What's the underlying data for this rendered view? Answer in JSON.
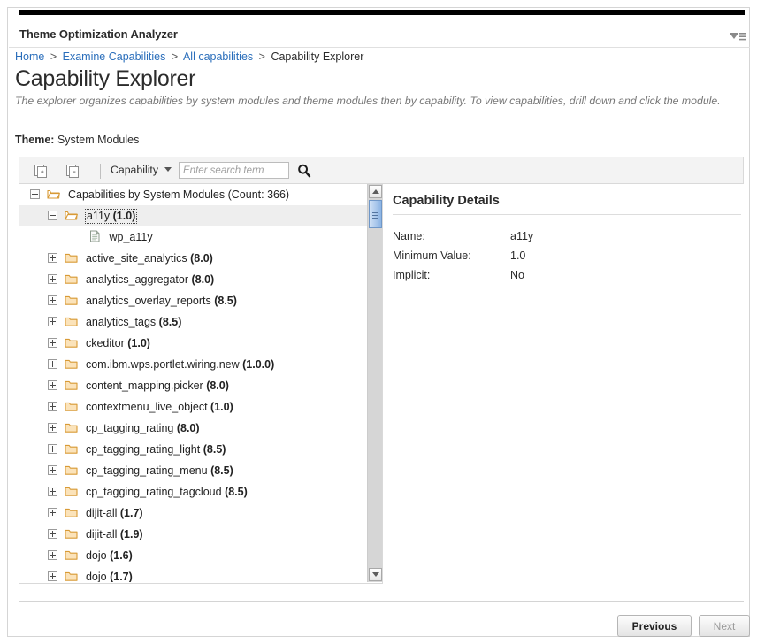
{
  "window": {
    "app_title": "Theme Optimization Analyzer",
    "corner_menu_icon": "options-menu-icon"
  },
  "breadcrumb": {
    "items": [
      {
        "label": "Home",
        "link": true
      },
      {
        "label": "Examine Capabilities",
        "link": true
      },
      {
        "label": "All capabilities",
        "link": true
      },
      {
        "label": "Capability Explorer",
        "link": false
      }
    ],
    "separator": ">"
  },
  "page": {
    "title": "Capability Explorer",
    "description": "The explorer organizes capabilities by system modules and theme modules then by capability. To view capabilities, drill down and click the module.",
    "theme_label": "Theme:",
    "theme_value": "System Modules"
  },
  "toolbar": {
    "expand_all_icon": "expand-all-icon",
    "collapse_all_icon": "collapse-all-icon",
    "filter_label": "Capability",
    "caret_icon": "chevron-down-icon",
    "search_placeholder": "Enter search term",
    "search_value": "",
    "search_icon": "search-icon"
  },
  "tree": {
    "root": {
      "label": "Capabilities by System Modules (Count: 366)",
      "icon": "folder-open-icon",
      "expanded": true
    },
    "nodes": [
      {
        "label": "a11y",
        "version": "(1.0)",
        "icon": "folder-open-icon",
        "expanded": true,
        "selected": true,
        "focused": true,
        "depth": 1
      },
      {
        "label": "wp_a11y",
        "version": "",
        "icon": "document-icon",
        "leaf": true,
        "depth": 2
      },
      {
        "label": "active_site_analytics",
        "version": "(8.0)",
        "icon": "folder-icon",
        "expanded": false,
        "depth": 1
      },
      {
        "label": "analytics_aggregator",
        "version": "(8.0)",
        "icon": "folder-icon",
        "expanded": false,
        "depth": 1
      },
      {
        "label": "analytics_overlay_reports",
        "version": "(8.5)",
        "icon": "folder-icon",
        "expanded": false,
        "depth": 1
      },
      {
        "label": "analytics_tags",
        "version": "(8.5)",
        "icon": "folder-icon",
        "expanded": false,
        "depth": 1
      },
      {
        "label": "ckeditor",
        "version": "(1.0)",
        "icon": "folder-icon",
        "expanded": false,
        "depth": 1
      },
      {
        "label": "com.ibm.wps.portlet.wiring.new",
        "version": "(1.0.0)",
        "icon": "folder-icon",
        "expanded": false,
        "depth": 1
      },
      {
        "label": "content_mapping.picker",
        "version": "(8.0)",
        "icon": "folder-icon",
        "expanded": false,
        "depth": 1
      },
      {
        "label": "contextmenu_live_object",
        "version": "(1.0)",
        "icon": "folder-icon",
        "expanded": false,
        "depth": 1
      },
      {
        "label": "cp_tagging_rating",
        "version": "(8.0)",
        "icon": "folder-icon",
        "expanded": false,
        "depth": 1
      },
      {
        "label": "cp_tagging_rating_light",
        "version": "(8.5)",
        "icon": "folder-icon",
        "expanded": false,
        "depth": 1
      },
      {
        "label": "cp_tagging_rating_menu",
        "version": "(8.5)",
        "icon": "folder-icon",
        "expanded": false,
        "depth": 1
      },
      {
        "label": "cp_tagging_rating_tagcloud",
        "version": "(8.5)",
        "icon": "folder-icon",
        "expanded": false,
        "depth": 1
      },
      {
        "label": "dijit-all",
        "version": "(1.7)",
        "icon": "folder-icon",
        "expanded": false,
        "depth": 1
      },
      {
        "label": "dijit-all",
        "version": "(1.9)",
        "icon": "folder-icon",
        "expanded": false,
        "depth": 1
      },
      {
        "label": "dojo",
        "version": "(1.6)",
        "icon": "folder-icon",
        "expanded": false,
        "depth": 1
      },
      {
        "label": "dojo",
        "version": "(1.7)",
        "icon": "folder-icon",
        "expanded": false,
        "depth": 1
      }
    ],
    "scrollbar": {
      "up_arrow_icon": "scroll-up-icon",
      "down_arrow_icon": "scroll-down-icon"
    }
  },
  "details": {
    "title": "Capability Details",
    "rows": [
      {
        "key": "Name:",
        "value": "a11y"
      },
      {
        "key": "Minimum Value:",
        "value": "1.0"
      },
      {
        "key": "Implicit:",
        "value": "No"
      }
    ]
  },
  "footer": {
    "previous_label": "Previous",
    "next_label": "Next",
    "next_disabled": true
  },
  "colors": {
    "link": "#2a6ebb",
    "folder": "#e8a33d",
    "selection": "#eeeeee",
    "scroll_thumb": "#8cb4e4",
    "toolbar_bg": "#f3f3f3"
  }
}
